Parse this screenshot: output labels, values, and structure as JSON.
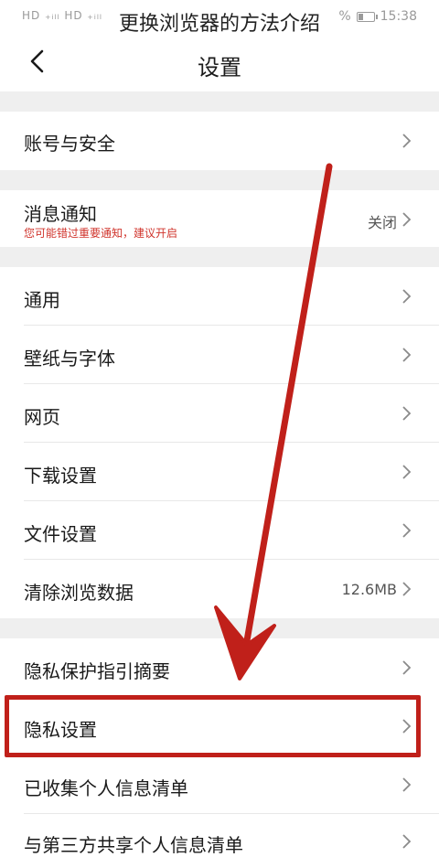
{
  "status_bar": {
    "left_text": "HD ₊ᵢₗₗ HD ₊ᵢₗₗ",
    "battery_text": "%",
    "time": "15:38"
  },
  "overlay_title": "更换浏览器的方法介绍",
  "nav": {
    "title": "设置"
  },
  "settings": {
    "account": {
      "label": "账号与安全"
    },
    "notification": {
      "label": "消息通知",
      "sub": "您可能错过重要通知，建议开启",
      "value": "关闭"
    },
    "general": {
      "label": "通用"
    },
    "wallpaper": {
      "label": "壁纸与字体"
    },
    "webpage": {
      "label": "网页"
    },
    "download": {
      "label": "下载设置"
    },
    "files": {
      "label": "文件设置"
    },
    "clear_data": {
      "label": "清除浏览数据",
      "value": "12.6MB"
    },
    "privacy_summary": {
      "label": "隐私保护指引摘要"
    },
    "privacy_settings": {
      "label": "隐私设置"
    },
    "collected_info": {
      "label": "已收集个人信息清单"
    },
    "third_party": {
      "label": "与第三方共享个人信息清单"
    }
  },
  "colors": {
    "annotation_red": "#c0201a",
    "warning_red": "#d0342c",
    "section_gap": "#efefef"
  }
}
